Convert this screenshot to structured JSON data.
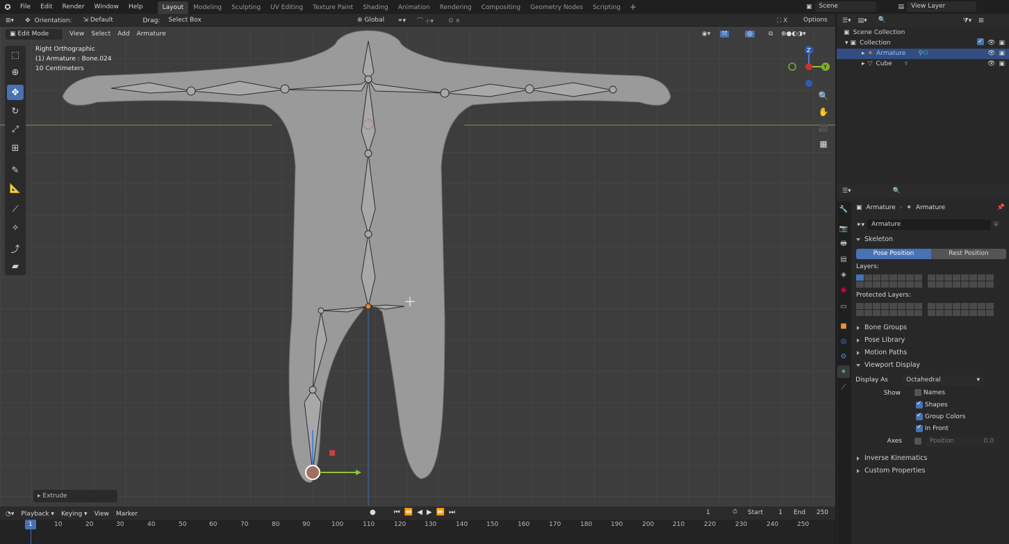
{
  "menu": {
    "file": "File",
    "edit": "Edit",
    "render": "Render",
    "window": "Window",
    "help": "Help"
  },
  "workspaces": [
    "Layout",
    "Modeling",
    "Sculpting",
    "UV Editing",
    "Texture Paint",
    "Shading",
    "Animation",
    "Rendering",
    "Compositing",
    "Geometry Nodes",
    "Scripting"
  ],
  "scene": {
    "name": "Scene",
    "view_layer": "View Layer"
  },
  "tool_header": {
    "orientation_label": "Orientation:",
    "orientation_value": "Default",
    "drag_label": "Drag:",
    "drag_value": "Select Box",
    "transform_space": "Global",
    "options": "Options"
  },
  "header2": {
    "mode": "Edit Mode",
    "view": "View",
    "select": "Select",
    "add": "Add",
    "armature": "Armature"
  },
  "viewport": {
    "view_name": "Right Orthographic",
    "object_info": "(1) Armature : Bone.024",
    "scale": "10 Centimeters",
    "last_op": "Extrude"
  },
  "gizmo": {
    "z": "Z",
    "y": "Y"
  },
  "outliner": {
    "scene_collection": "Scene Collection",
    "collection": "Collection",
    "items": [
      "Armature",
      "Cube"
    ]
  },
  "properties": {
    "breadcrumb_object": "Armature",
    "breadcrumb_data": "Armature",
    "data_name": "Armature",
    "skeleton": "Skeleton",
    "pose_position": "Pose Position",
    "rest_position": "Rest Position",
    "layers": "Layers:",
    "protected_layers": "Protected Layers:",
    "bone_groups": "Bone Groups",
    "pose_library": "Pose Library",
    "motion_paths": "Motion Paths",
    "viewport_display": "Viewport Display",
    "display_as_label": "Display As",
    "display_as_value": "Octahedral",
    "show_label": "Show",
    "names": "Names",
    "shapes": "Shapes",
    "group_colors": "Group Colors",
    "in_front": "In Front",
    "axes_label": "Axes",
    "position_label": "Position",
    "position_value": "0.0",
    "inverse_kinematics": "Inverse Kinematics",
    "custom_properties": "Custom Properties"
  },
  "timeline": {
    "playback": "Playback",
    "keying": "Keying",
    "view": "View",
    "marker": "Marker",
    "current_frame": "1",
    "start_label": "Start",
    "start": "1",
    "end_label": "End",
    "end": "250",
    "ruler": [
      "1",
      "10",
      "20",
      "30",
      "40",
      "50",
      "60",
      "70",
      "80",
      "90",
      "100",
      "110",
      "120",
      "130",
      "140",
      "150",
      "160",
      "170",
      "180",
      "190",
      "200",
      "210",
      "220",
      "230",
      "240",
      "250"
    ]
  }
}
